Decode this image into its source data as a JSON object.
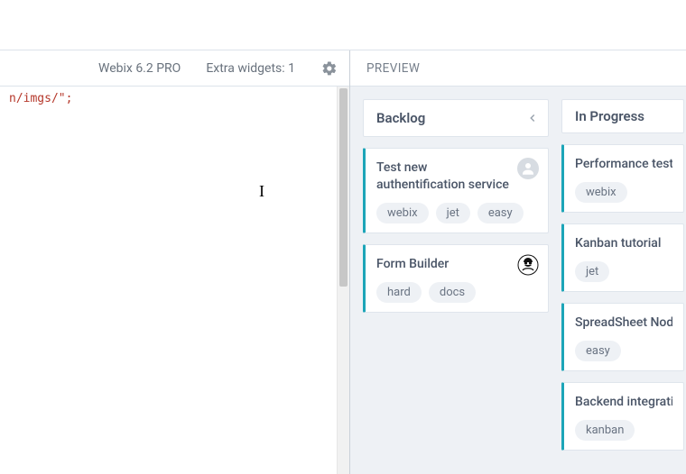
{
  "left": {
    "version_label": "Webix 6.2 PRO",
    "extra_widgets_label": "Extra widgets: 1",
    "code_fragment": "n/imgs/\";"
  },
  "preview_label": "PREVIEW",
  "columns": [
    {
      "title": "Backlog",
      "collapse": true,
      "cards": [
        {
          "title": "Test new authentification service",
          "avatar": "person",
          "tags": [
            "webix",
            "jet",
            "easy"
          ]
        },
        {
          "title": "Form Builder",
          "avatar": "agent",
          "tags": [
            "hard",
            "docs"
          ]
        }
      ]
    },
    {
      "title": "In Progress",
      "collapse": false,
      "cards": [
        {
          "title": "Performance tests",
          "tags": [
            "webix"
          ]
        },
        {
          "title": "Kanban tutorial",
          "tags": [
            "jet"
          ]
        },
        {
          "title": "SpreadSheet NodeJS",
          "tags": [
            "easy"
          ]
        },
        {
          "title": "Backend integration",
          "tags": [
            "kanban"
          ]
        }
      ]
    }
  ]
}
